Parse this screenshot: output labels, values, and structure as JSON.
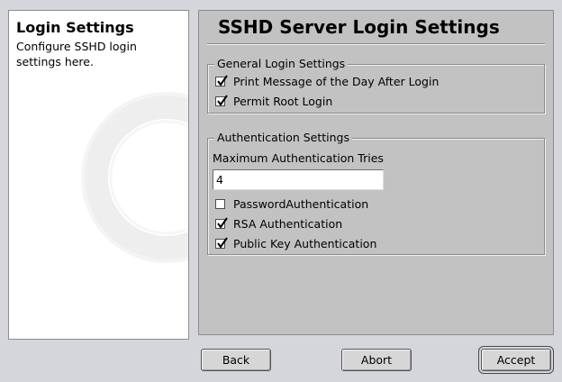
{
  "help": {
    "title": "Login Settings",
    "text": "Configure SSHD login settings here."
  },
  "main": {
    "title": "SSHD Server Login Settings",
    "general_group": {
      "legend": "General Login Settings",
      "items": [
        {
          "label": "Print Message of the Day After Login",
          "checked": true
        },
        {
          "label": "Permit Root Login",
          "checked": true
        }
      ]
    },
    "auth_group": {
      "legend": "Authentication Settings",
      "max_tries_label": "Maximum Authentication Tries",
      "max_tries_value": "4",
      "items": [
        {
          "label": "PasswordAuthentication",
          "checked": false
        },
        {
          "label": "RSA Authentication",
          "checked": true
        },
        {
          "label": "Public Key Authentication",
          "checked": true
        }
      ]
    }
  },
  "buttons": {
    "back": "Back",
    "abort": "Abort",
    "accept": "Accept"
  },
  "icons": {
    "checkmark": "checkmark-icon",
    "watermark": "lifebuoy-icon"
  }
}
